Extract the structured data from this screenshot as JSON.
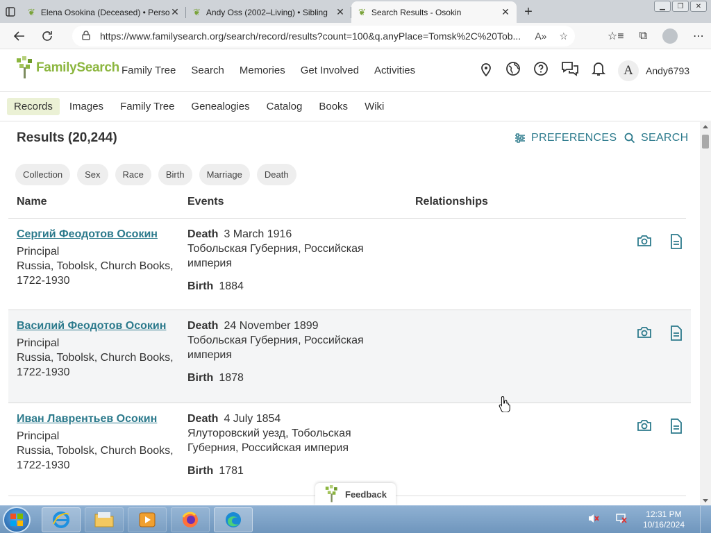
{
  "browser": {
    "tabs": [
      {
        "title": "Elena Osokina (Deceased) • Perso",
        "active": false
      },
      {
        "title": "Andy Oss (2002–Living) • Sibling",
        "active": false
      },
      {
        "title": "Search Results - Osokin",
        "active": true
      }
    ],
    "tab_close": "✕",
    "new_tab": "+",
    "url": "https://www.familysearch.org/search/record/results?count=100&q.anyPlace=Tomsk%2C%20Tob..."
  },
  "header": {
    "logo_text": "FamilySearch",
    "nav": [
      "Family Tree",
      "Search",
      "Memories",
      "Get Involved",
      "Activities"
    ],
    "avatar_letter": "A",
    "username": "Andy6793"
  },
  "subnav": {
    "items": [
      "Records",
      "Images",
      "Family Tree",
      "Genealogies",
      "Catalog",
      "Books",
      "Wiki"
    ],
    "active": "Records"
  },
  "results": {
    "title": "Results (20,244)",
    "preferences_label": "PREFERENCES",
    "search_label": "SEARCH",
    "chips": [
      "Collection",
      "Sex",
      "Race",
      "Birth",
      "Marriage",
      "Death"
    ],
    "columns": {
      "name": "Name",
      "events": "Events",
      "relationships": "Relationships"
    },
    "rows": [
      {
        "name": "Сергий Феодотов Осокин",
        "role": "Principal",
        "collection": "Russia, Tobolsk, Church Books, 1722-1930",
        "death_label": "Death",
        "death_date": "3 March 1916",
        "death_place": "Тобольская Губерния, Российская империя",
        "birth_label": "Birth",
        "birth_date": "1884"
      },
      {
        "name": "Василий Феодотов Осокин",
        "role": "Principal",
        "collection": "Russia, Tobolsk, Church Books, 1722-1930",
        "death_label": "Death",
        "death_date": "24 November 1899",
        "death_place": "Тобольская Губерния, Российская империя",
        "birth_label": "Birth",
        "birth_date": "1878"
      },
      {
        "name": "Иван Лаврентьев Осокин",
        "role": "Principal",
        "collection": "Russia, Tobolsk, Church Books, 1722-1930",
        "death_label": "Death",
        "death_date": "4 July 1854",
        "death_place": "Ялуторовский уезд, Тобольская Губерния, Российская империя",
        "birth_label": "Birth",
        "birth_date": "1781"
      }
    ]
  },
  "feedback_label": "Feedback",
  "taskbar": {
    "time": "12:31 PM",
    "date": "10/16/2024"
  },
  "colors": {
    "link_teal": "#2c7a8c",
    "brand_green": "#8cb63f",
    "active_subnav": "#ebf1d5"
  }
}
